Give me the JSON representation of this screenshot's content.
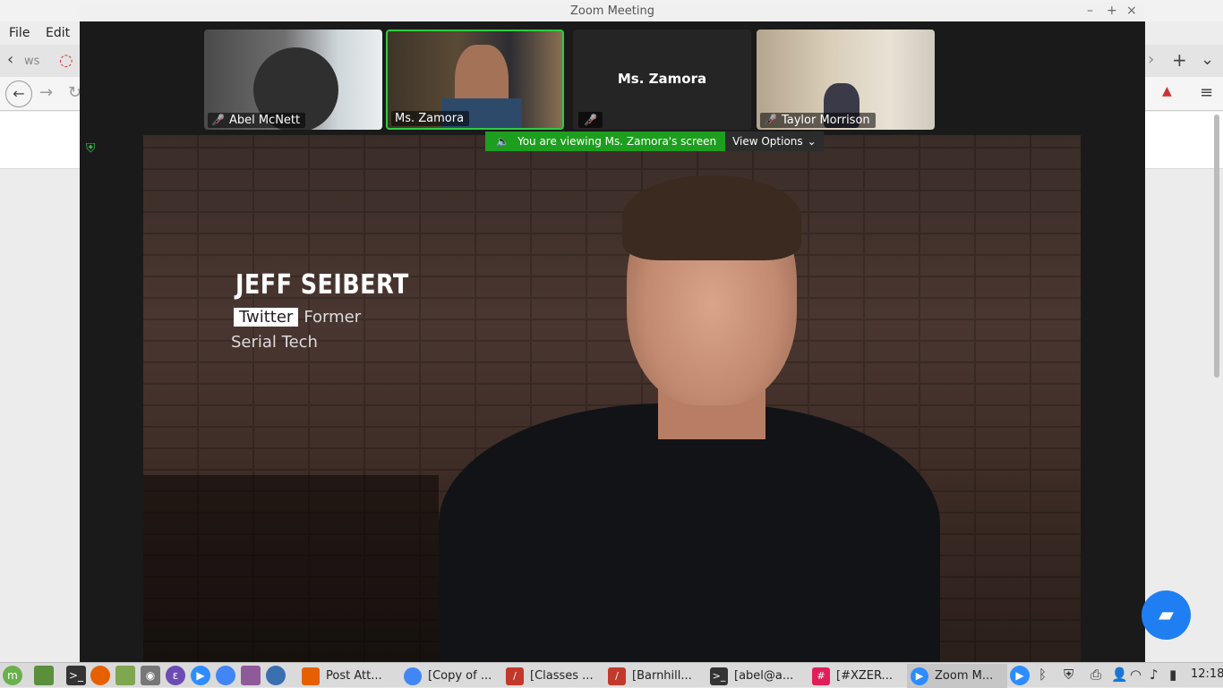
{
  "browser": {
    "menu": {
      "file": "File",
      "edit": "Edit"
    },
    "tab_fragment": "ws"
  },
  "zoom": {
    "title": "Zoom Meeting",
    "participants": [
      {
        "name": "Abel McNett",
        "muted": true
      },
      {
        "name": "Ms. Zamora",
        "muted": false,
        "active": true
      },
      {
        "name": "Ms. Zamora",
        "muted": true,
        "video": false
      },
      {
        "name": "Taylor Morrison",
        "muted": true
      }
    ],
    "banner": {
      "text": "You are viewing Ms. Zamora's screen",
      "options": "View Options"
    },
    "shared": {
      "caption_name": "JEFF SEIBERT",
      "caption_company": "Twitter",
      "caption_former": "Former",
      "caption_role": "Serial Tech"
    }
  },
  "taskbar": {
    "tasks": [
      {
        "label": "Post Att...",
        "color": "#e66000"
      },
      {
        "label": "[Copy of ...",
        "color": "#4285f4"
      },
      {
        "label": "[Classes ...",
        "color": "#c0392b"
      },
      {
        "label": "[Barnhill...",
        "color": "#c0392b"
      },
      {
        "label": "[abel@a...",
        "color": "#333333"
      },
      {
        "label": "[#XZER...",
        "color": "#e01e5a"
      },
      {
        "label": "Zoom M...",
        "color": "#2d8cff"
      }
    ],
    "clock": "12:18"
  }
}
